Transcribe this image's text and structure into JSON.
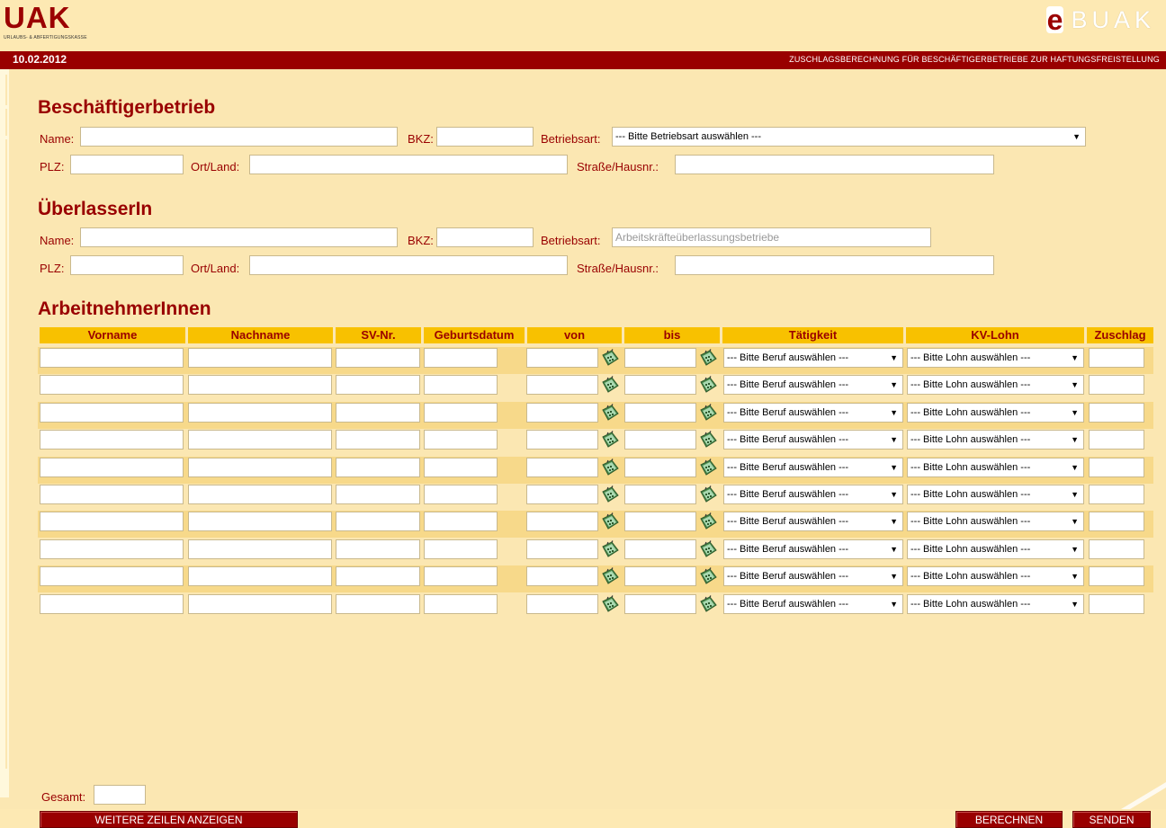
{
  "header": {
    "logo_text": "UAK",
    "logo_sub": "URLAUBS- & ABFERTIGUNGSKASSE",
    "brand_e": "e",
    "brand_text": "BUAK",
    "date": "10.02.2012",
    "page_title": "ZUSCHLAGSBERECHNUNG FÜR BESCHÄFTIGERBETRIEBE ZUR HAFTUNGSFREISTELLUNG"
  },
  "beschaeftiger": {
    "heading": "Beschäftigerbetrieb",
    "name_label": "Name:",
    "bkz_label": "BKZ:",
    "betriebsart_label": "Betriebsart:",
    "betriebsart_value": "--- Bitte Betriebsart auswählen ---",
    "plz_label": "PLZ:",
    "ort_label": "Ort/Land:",
    "strasse_label": "Straße/Hausnr.:"
  },
  "ueberlasser": {
    "heading": "ÜberlasserIn",
    "name_label": "Name:",
    "bkz_label": "BKZ:",
    "betriebsart_label": "Betriebsart:",
    "betriebsart_value": "Arbeitskräfteüberlassungsbetriebe",
    "plz_label": "PLZ:",
    "ort_label": "Ort/Land:",
    "strasse_label": "Straße/Hausnr.:"
  },
  "arbeitnehmer": {
    "heading": "ArbeitnehmerInnen",
    "columns": [
      "Vorname",
      "Nachname",
      "SV-Nr.",
      "Geburtsdatum",
      "von",
      "bis",
      "Tätigkeit",
      "KV-Lohn",
      "Zuschlag"
    ],
    "beruf_placeholder": "--- Bitte Beruf auswählen ---",
    "lohn_placeholder": "--- Bitte Lohn auswählen ---",
    "row_count": 10
  },
  "footer": {
    "gesamt_label": "Gesamt:",
    "more_rows_button": "WEITERE ZEILEN ANZEIGEN",
    "calc_button": "BERECHNEN",
    "send_button": "SENDEN"
  },
  "colors": {
    "brand_red": "#990000",
    "background": "#fbe7b2",
    "header_yellow": "#f8c100"
  },
  "icons": [
    "calendar-icon",
    "dropdown-arrow-icon"
  ]
}
